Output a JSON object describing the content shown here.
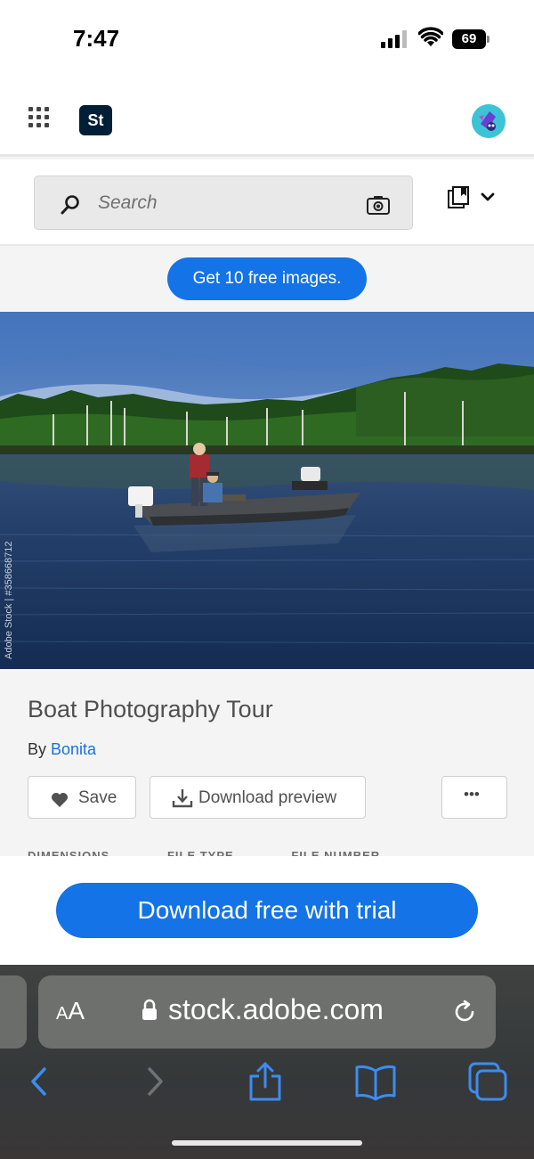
{
  "status_bar": {
    "time": "7:47",
    "battery": "69"
  },
  "header": {
    "app_logo": "St",
    "icons": [
      "apps-grid-icon",
      "user-avatar"
    ]
  },
  "search": {
    "placeholder": "Search",
    "icons": [
      "search-icon",
      "camera-icon",
      "collection-icon",
      "chevron-down-icon"
    ]
  },
  "promo": {
    "label": "Get 10 free images."
  },
  "image": {
    "watermark_id": "Adobe Stock | #358668712"
  },
  "details": {
    "title": "Boat Photography Tour",
    "by_prefix": "By",
    "author": "Bonita",
    "save_label": "Save",
    "download_preview_label": "Download preview",
    "more_label": "•••",
    "meta_headers": [
      "DIMENSIONS",
      "FILE TYPE",
      "FILE NUMBER"
    ]
  },
  "cta": {
    "label": "Download free with trial"
  },
  "browser": {
    "aa_small": "A",
    "aa_big": "A",
    "url": "stock.adobe.com",
    "toolbar_icons": [
      "back-icon",
      "forward-icon",
      "share-icon",
      "bookmarks-icon",
      "tabs-icon"
    ]
  },
  "colors": {
    "accent": "#1473e6",
    "adobe_dark": "#001e36"
  }
}
